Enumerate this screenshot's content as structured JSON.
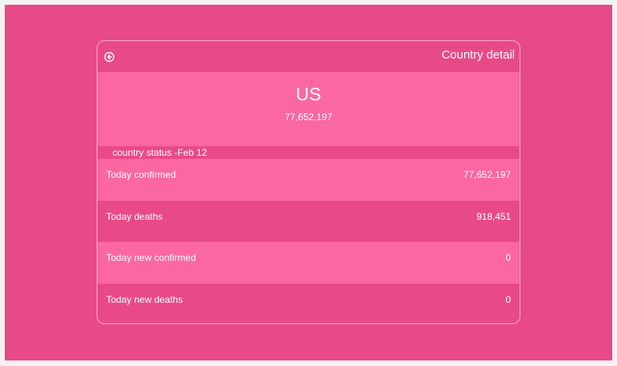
{
  "header": {
    "title": "Country detail",
    "back_icon": "circle-arrow-left-icon"
  },
  "hero": {
    "country": "US",
    "total": "77,652,197"
  },
  "status": {
    "label": "country status -Feb 12"
  },
  "rows": [
    {
      "label": "Today confirmed",
      "value": "77,652,197"
    },
    {
      "label": "Today deaths",
      "value": "918,451"
    },
    {
      "label": "Today new confirmed",
      "value": "0"
    },
    {
      "label": "Today new deaths",
      "value": "0"
    }
  ],
  "colors": {
    "background": "#e84a87",
    "accent": "#fb67a0",
    "text": "#ffffff",
    "outer": "#f3f3f3"
  }
}
